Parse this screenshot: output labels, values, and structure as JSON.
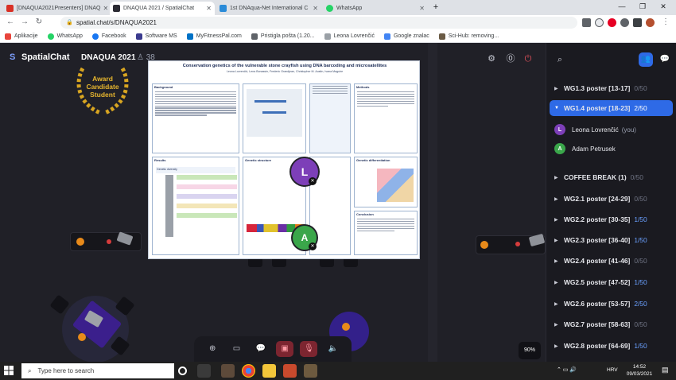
{
  "browser": {
    "tabs": [
      {
        "title": "[DNAQUA2021Presenters] DNAQ",
        "favicon_color": "#d93025"
      },
      {
        "title": "DNAQUA 2021 / SpatialChat",
        "favicon_color": "#2b2b33"
      },
      {
        "title": "1st DNAqua-Net International C",
        "favicon_color": "#2a8bd8"
      },
      {
        "title": "WhatsApp",
        "favicon_color": "#25d366"
      }
    ],
    "new_tab": "+",
    "url": "spatial.chat/s/DNAQUA2021",
    "bookmarks": [
      {
        "label": "Aplikacije",
        "icon": "apps-grid-icon",
        "color": "#e8453c"
      },
      {
        "label": "WhatsApp",
        "icon": "whatsapp-icon",
        "color": "#25d366"
      },
      {
        "label": "Facebook",
        "icon": "facebook-icon",
        "color": "#1877f2"
      },
      {
        "label": "Software MS",
        "icon": "w-icon",
        "color": "#3b3b8f"
      },
      {
        "label": "MyFitnessPal.com",
        "icon": "myfitnesspal-icon",
        "color": "#0072c6"
      },
      {
        "label": "Pristigla pošta (1.20...",
        "icon": "gmail-icon",
        "color": "#5f6368"
      },
      {
        "label": "Leona Lovrenčić",
        "icon": "researchgate-icon",
        "color": "#9aa0a6"
      },
      {
        "label": "Google znalac",
        "icon": "scholar-icon",
        "color": "#4285f4"
      },
      {
        "label": "Sci-Hub: removing...",
        "icon": "scihub-icon",
        "color": "#6b5b45"
      }
    ]
  },
  "app": {
    "brand": "SpatialChat",
    "room": "DNAQUA 2021",
    "participants_icon": "person-icon",
    "participants": "38",
    "award_badge": {
      "line1": "Award",
      "line2": "Candidate",
      "line3": "Student"
    },
    "zoom": "90%",
    "accent": "#2e6ae6"
  },
  "poster": {
    "title": "Conservation genetics of the vulnerable stone crayfish using DNA barcoding and microsatellites",
    "authors": "Leona Lovrenčić, Lena Bonassin, Frederic Grandjean, Christopher M. Austin, Ivana Maguire",
    "sections": {
      "background": "Background",
      "methods": "Methods",
      "results": "Results",
      "genetic_diversity": "Genetic diversity",
      "genetic_structure": "Genetic structure",
      "differentiation": "Genetic differentiation",
      "conclusion": "Conclusion"
    }
  },
  "avatars": [
    {
      "initial": "L",
      "color": "#7d3fb8"
    },
    {
      "initial": "A",
      "color": "#3aa64a"
    }
  ],
  "sidebar": {
    "rooms": [
      {
        "label": "WG1.3 poster [13-17]",
        "count": "0/50",
        "active": false
      },
      {
        "label": "WG1.4 poster [18-23]",
        "count": "2/50",
        "active": true
      },
      {
        "label": "COFFEE BREAK (1)",
        "count": "0/50",
        "active": false
      },
      {
        "label": "WG2.1 poster [24-29]",
        "count": "0/50",
        "active": false
      },
      {
        "label": "WG2.2 poster [30-35]",
        "count": "1/50",
        "active": false
      },
      {
        "label": "WG2.3 poster [36-40]",
        "count": "1/50",
        "active": false
      },
      {
        "label": "WG2.4 poster [41-46]",
        "count": "0/50",
        "active": false
      },
      {
        "label": "WG2.5 poster [47-52]",
        "count": "1/50",
        "active": false
      },
      {
        "label": "WG2.6 poster [53-57]",
        "count": "2/50",
        "active": false
      },
      {
        "label": "WG2.7 poster [58-63]",
        "count": "0/50",
        "active": false
      },
      {
        "label": "WG2.8 poster [64-69]",
        "count": "1/50",
        "active": false
      }
    ],
    "members": [
      {
        "initial": "L",
        "name": "Leona Lovrenčić",
        "suffix": "(you)",
        "color": "#7d3fb8"
      },
      {
        "initial": "A",
        "name": "Adam Petrusek",
        "suffix": "",
        "color": "#3aa64a"
      }
    ]
  },
  "taskbar": {
    "search_placeholder": "Type here to search",
    "language": "HRV",
    "time": "14:52",
    "date": "09/03/2021"
  }
}
